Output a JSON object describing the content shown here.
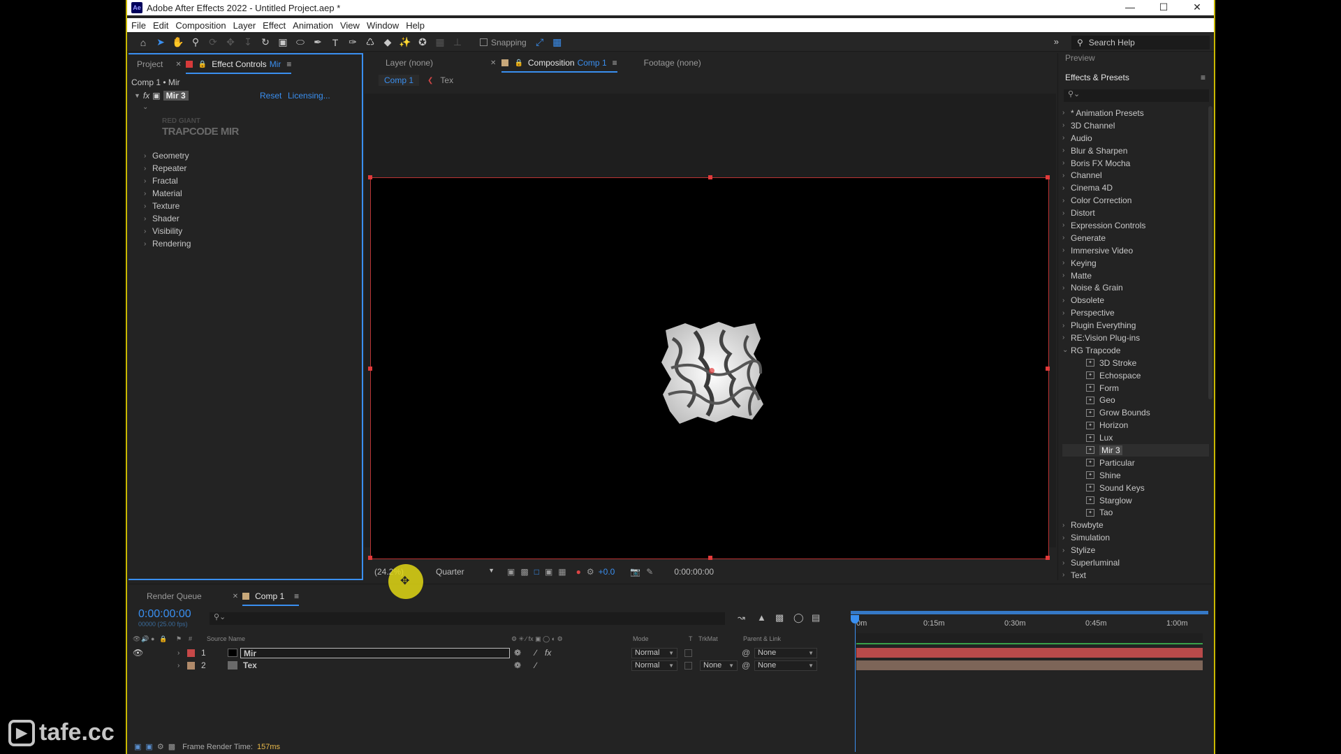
{
  "window": {
    "title": "Adobe After Effects 2022 - Untitled Project.aep *",
    "app_icon": "Ae",
    "controls": [
      "minimize-icon",
      "maximize-icon",
      "close-icon"
    ]
  },
  "menu": [
    "File",
    "Edit",
    "Composition",
    "Layer",
    "Effect",
    "Animation",
    "View",
    "Window",
    "Help"
  ],
  "toolbar": {
    "snapping_label": "Snapping",
    "search_help": "Search Help"
  },
  "project_panel": {
    "tab_project": "Project",
    "tab_effect_controls": "Effect Controls",
    "effect_controls_layer": "Mir",
    "breadcrumb": "Comp 1 • Mir",
    "fx_label": "fx",
    "effect_name": "Mir 3",
    "reset_label": "Reset",
    "licensing_label": "Licensing...",
    "logo_line1": "RED GIANT",
    "logo_line2": "TRAPCODE MIR",
    "groups": [
      "Geometry",
      "Repeater",
      "Fractal",
      "Material",
      "Texture",
      "Shader",
      "Visibility",
      "Rendering"
    ]
  },
  "comp_panel": {
    "tab_layer": "Layer (none)",
    "tab_composition": "Composition",
    "tab_composition_name": "Comp 1",
    "tab_footage": "Footage (none)",
    "sub_comp": "Comp 1",
    "sub_tex": "Tex",
    "zoom": "(24.2%)",
    "resolution": "Quarter",
    "exposure": "+0.0",
    "timecode": "0:00:00:00"
  },
  "presets_panel": {
    "preview_label": "Preview",
    "title": "Effects & Presets",
    "search_placeholder": "",
    "categories_top": [
      "* Animation Presets",
      "3D Channel",
      "Audio",
      "Blur & Sharpen",
      "Boris FX Mocha",
      "Channel",
      "Cinema 4D",
      "Color Correction",
      "Distort",
      "Expression Controls",
      "Generate",
      "Immersive Video",
      "Keying",
      "Matte",
      "Noise & Grain",
      "Obsolete",
      "Perspective",
      "Plugin Everything",
      "RE:Vision Plug-ins"
    ],
    "open_category": "RG Trapcode",
    "open_children": [
      "3D Stroke",
      "Echospace",
      "Form",
      "Geo",
      "Grow Bounds",
      "Horizon",
      "Lux",
      "Mir 3",
      "Particular",
      "Shine",
      "Sound Keys",
      "Starglow",
      "Tao"
    ],
    "selected_child": "Mir 3",
    "categories_bottom": [
      "Rowbyte",
      "Simulation",
      "Stylize",
      "Superluminal",
      "Text"
    ]
  },
  "timeline": {
    "tab_render_queue": "Render Queue",
    "tab_comp": "Comp 1",
    "current_time": "0:00:00:00",
    "fps": "00000 (25.00 fps)",
    "col_number": "#",
    "col_source": "Source Name",
    "col_mode": "Mode",
    "col_t": "T",
    "col_trkmat": "TrkMat",
    "col_parent": "Parent & Link",
    "ruler_labels": [
      "0m",
      "0:15m",
      "0:30m",
      "0:45m",
      "1:00m"
    ],
    "layers": [
      {
        "num": "1",
        "name": "Mir",
        "mode": "Normal",
        "trkmat": "",
        "parent": "None",
        "color": "#c74848",
        "bar_color": "#b84a4a"
      },
      {
        "num": "2",
        "name": "Tex",
        "mode": "Normal",
        "trkmat": "None",
        "parent": "None",
        "color": "#b08a6a",
        "bar_color": "#7d6558"
      }
    ],
    "status_label": "Frame Render Time:",
    "status_value": "157ms"
  },
  "watermark": "tafe.cc"
}
